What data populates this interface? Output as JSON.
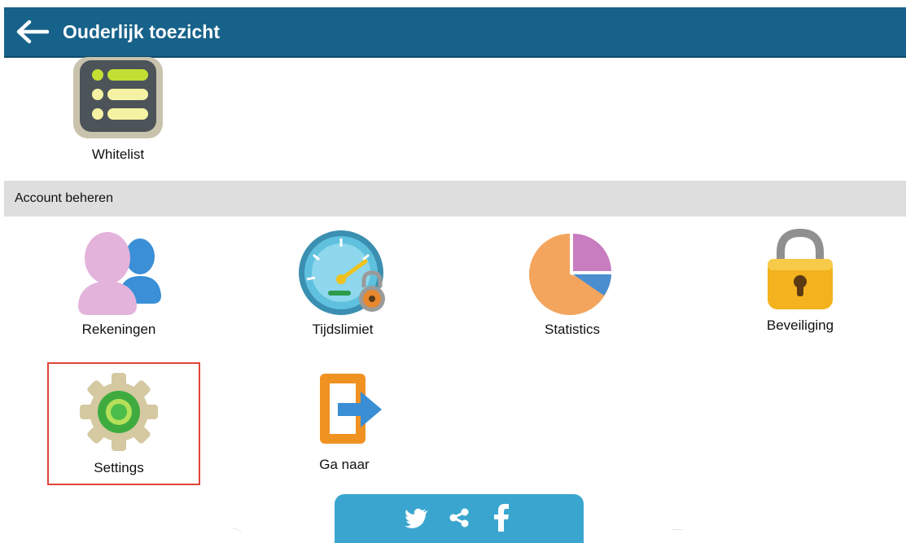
{
  "header": {
    "title": "Ouderlijk toezicht",
    "back_icon": "arrow-left-icon"
  },
  "top_tiles": [
    {
      "label": "Whitelist",
      "icon": "list-icon"
    }
  ],
  "section": {
    "label": "Account beheren"
  },
  "tiles": [
    {
      "label": "Rekeningen",
      "icon": "users-icon"
    },
    {
      "label": "Tijdslimiet",
      "icon": "speedometer-lock-icon"
    },
    {
      "label": "Statistics",
      "icon": "pie-chart-icon"
    },
    {
      "label": "Beveiliging",
      "icon": "padlock-icon"
    },
    {
      "label": "Settings",
      "icon": "gear-icon",
      "selected": true
    },
    {
      "label": "Ga naar",
      "icon": "exit-arrow-icon"
    }
  ],
  "share_bar": {
    "icons": [
      "twitter-icon",
      "share-icon",
      "facebook-icon"
    ]
  },
  "colors": {
    "header": "#17628a",
    "section": "#dedede",
    "selection": "#e0443a",
    "share": "#3aa6cf"
  }
}
